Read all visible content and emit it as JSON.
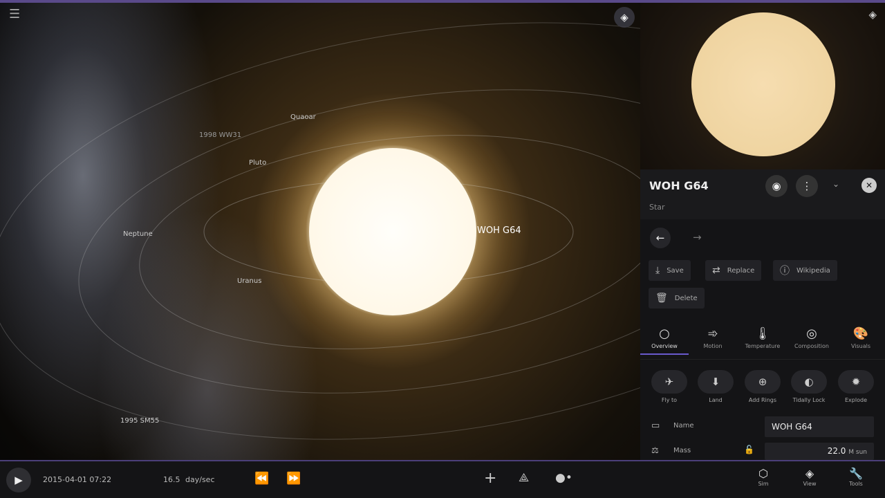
{
  "viewport": {
    "labels": {
      "selected": "WOH G64",
      "quaoar": "Quaoar",
      "minor": "1998 WW31",
      "pluto": "Pluto",
      "neptune": "Neptune",
      "uranus": "Uranus",
      "asteroid": "1995 SM55"
    }
  },
  "panel": {
    "title": "WOH G64",
    "subtitle": "Star",
    "actions": [
      {
        "label": "Save",
        "icon": "download-icon"
      },
      {
        "label": "Replace",
        "icon": "replace-icon"
      },
      {
        "label": "Wikipedia",
        "icon": "info-icon"
      },
      {
        "label": "Delete",
        "icon": "trash-icon"
      }
    ],
    "tabs": [
      {
        "label": "Overview"
      },
      {
        "label": "Motion"
      },
      {
        "label": "Temperature"
      },
      {
        "label": "Composition"
      },
      {
        "label": "Visuals"
      }
    ],
    "quick": [
      {
        "label": "Fly to"
      },
      {
        "label": "Land"
      },
      {
        "label": "Add Rings"
      },
      {
        "label": "Tidally Lock"
      },
      {
        "label": "Explode"
      }
    ],
    "props": {
      "name_label": "Name",
      "name_value": "WOH G64",
      "mass_label": "Mass",
      "mass_value": "22.0",
      "mass_unit": "M sun"
    }
  },
  "bottom": {
    "datetime": "2015-04-01 07:22",
    "speed_value": "16.5",
    "speed_unit": "day/sec",
    "sim": "Sim",
    "view": "View",
    "tools": "Tools"
  }
}
